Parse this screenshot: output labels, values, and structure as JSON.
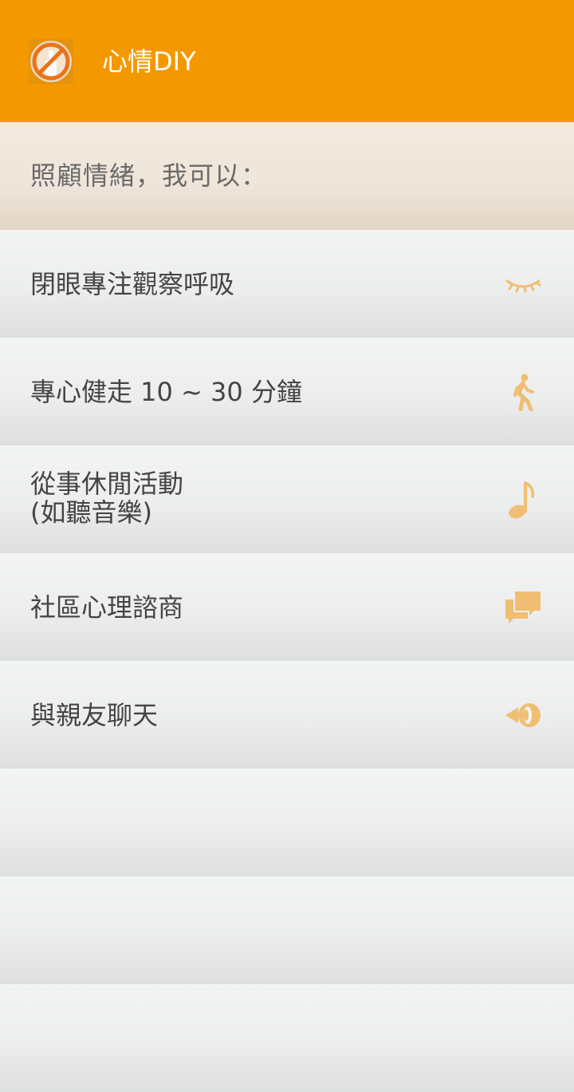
{
  "app_bar": {
    "title": "心情DIY",
    "icon": "no-bottle-icon",
    "background_color": "#F49800"
  },
  "subheader": {
    "text": "照顧情緒，我可以："
  },
  "list": {
    "items": [
      {
        "label": "閉眼專注觀察呼吸",
        "icon": "closed-eye-icon"
      },
      {
        "label": "專心健走 10 ~ 30 分鐘",
        "icon": "walking-person-icon"
      },
      {
        "label_lines": [
          "從事休閒活動",
          "(如聽音樂)"
        ],
        "icon": "music-note-icon"
      },
      {
        "label": "社區心理諮商",
        "icon": "chat-bubbles-icon"
      },
      {
        "label": "與親友聊天",
        "icon": "speaking-icon"
      }
    ],
    "icon_color": "#F0BE73"
  }
}
